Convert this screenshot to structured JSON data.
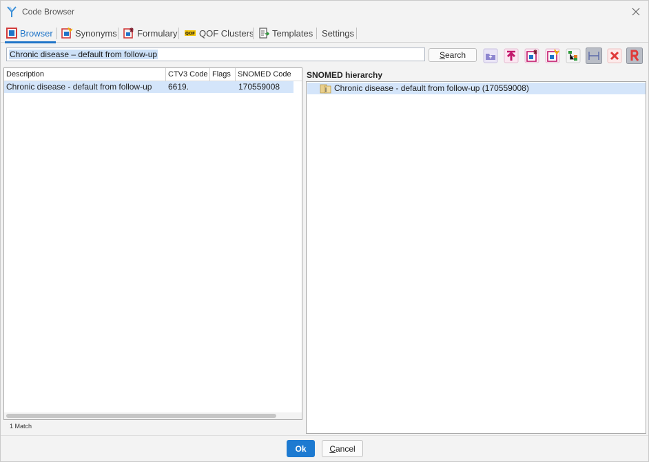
{
  "window": {
    "title": "Code Browser"
  },
  "tabs": [
    {
      "label": "Browser",
      "icon": "browser-icon",
      "active": true
    },
    {
      "label": "Synonyms",
      "icon": "synonyms-icon"
    },
    {
      "label": "Formulary",
      "icon": "formulary-icon"
    },
    {
      "label": "QOF Clusters",
      "icon": "qof-icon"
    },
    {
      "label": "Templates",
      "icon": "templates-icon"
    },
    {
      "label": "Settings"
    }
  ],
  "search": {
    "value": "Chronic disease – default from follow-up",
    "button_label_underlined": "S",
    "button_label_rest": "earch"
  },
  "toolbar_icons": [
    "parent-folder-icon",
    "move-to-top-icon",
    "add-code-icon",
    "edit-code-icon",
    "hierarchy-tree-icon",
    "toggle-view-icon",
    "clear-icon",
    "restore-icon"
  ],
  "list": {
    "columns": [
      "Description",
      "CTV3 Code",
      "Flags",
      "SNOMED Code"
    ],
    "rows": [
      {
        "description": "Chronic disease - default from follow-up",
        "ctv3": "6619.",
        "flags": "",
        "snomed": "170559008"
      }
    ],
    "match_count": "1 Match"
  },
  "hierarchy": {
    "title": "SNOMED hierarchy",
    "items": [
      {
        "label": "Chronic disease - default from follow-up (170559008)"
      }
    ]
  },
  "footer": {
    "ok_label": "Ok",
    "cancel_label_underlined": "C",
    "cancel_label_rest": "ancel"
  },
  "colors": {
    "accent": "#1e74c8",
    "selection": "#d4e5fa",
    "ok_button": "#1d7ad1",
    "danger": "#e03a3a",
    "icon_magenta": "#c2186b"
  }
}
